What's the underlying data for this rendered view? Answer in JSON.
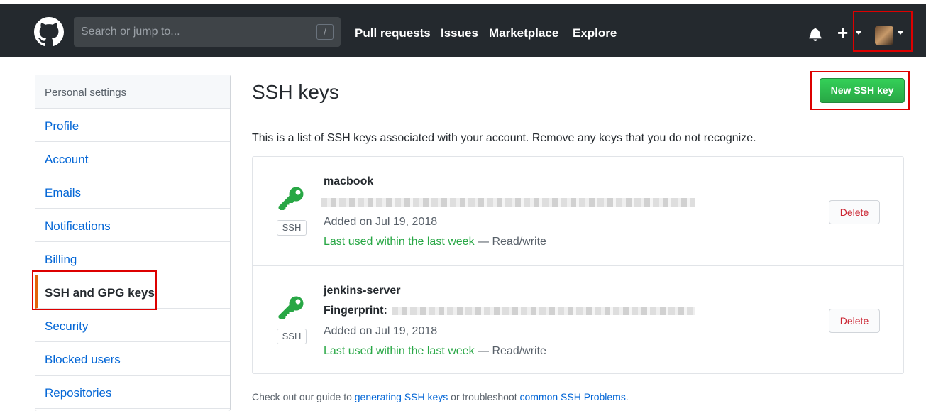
{
  "header": {
    "search_placeholder": "Search or jump to...",
    "slash_hint": "/",
    "nav": [
      "Pull requests",
      "Issues",
      "Marketplace",
      "Explore"
    ],
    "plus": "+"
  },
  "sidebar": {
    "heading": "Personal settings",
    "items": [
      {
        "label": "Profile"
      },
      {
        "label": "Account"
      },
      {
        "label": "Emails"
      },
      {
        "label": "Notifications"
      },
      {
        "label": "Billing"
      },
      {
        "label": "SSH and GPG keys",
        "selected": true
      },
      {
        "label": "Security"
      },
      {
        "label": "Blocked users"
      },
      {
        "label": "Repositories"
      }
    ]
  },
  "main": {
    "title": "SSH keys",
    "new_button": "New SSH key",
    "intro": "This is a list of SSH keys associated with your account. Remove any keys that you do not recognize.",
    "keys": [
      {
        "badge": "SSH",
        "name": "macbook",
        "fingerprint_label": "",
        "added": "Added on Jul 19, 2018",
        "last_used": "Last used within the last week",
        "access": "— Read/write",
        "delete_label": "Delete"
      },
      {
        "badge": "SSH",
        "name": "jenkins-server",
        "fingerprint_label": "Fingerprint:",
        "added": "Added on Jul 19, 2018",
        "last_used": "Last used within the last week",
        "access": "— Read/write",
        "delete_label": "Delete"
      }
    ],
    "footer": {
      "prefix": "Check out our guide to ",
      "link1": "generating SSH keys",
      "middle": " or troubleshoot ",
      "link2": "common SSH Problems",
      "suffix": "."
    }
  },
  "colors": {
    "header_bg": "#24292e",
    "link": "#0366d6",
    "green": "#28a745",
    "danger": "#cb2431",
    "highlight_box": "#dd0000"
  }
}
